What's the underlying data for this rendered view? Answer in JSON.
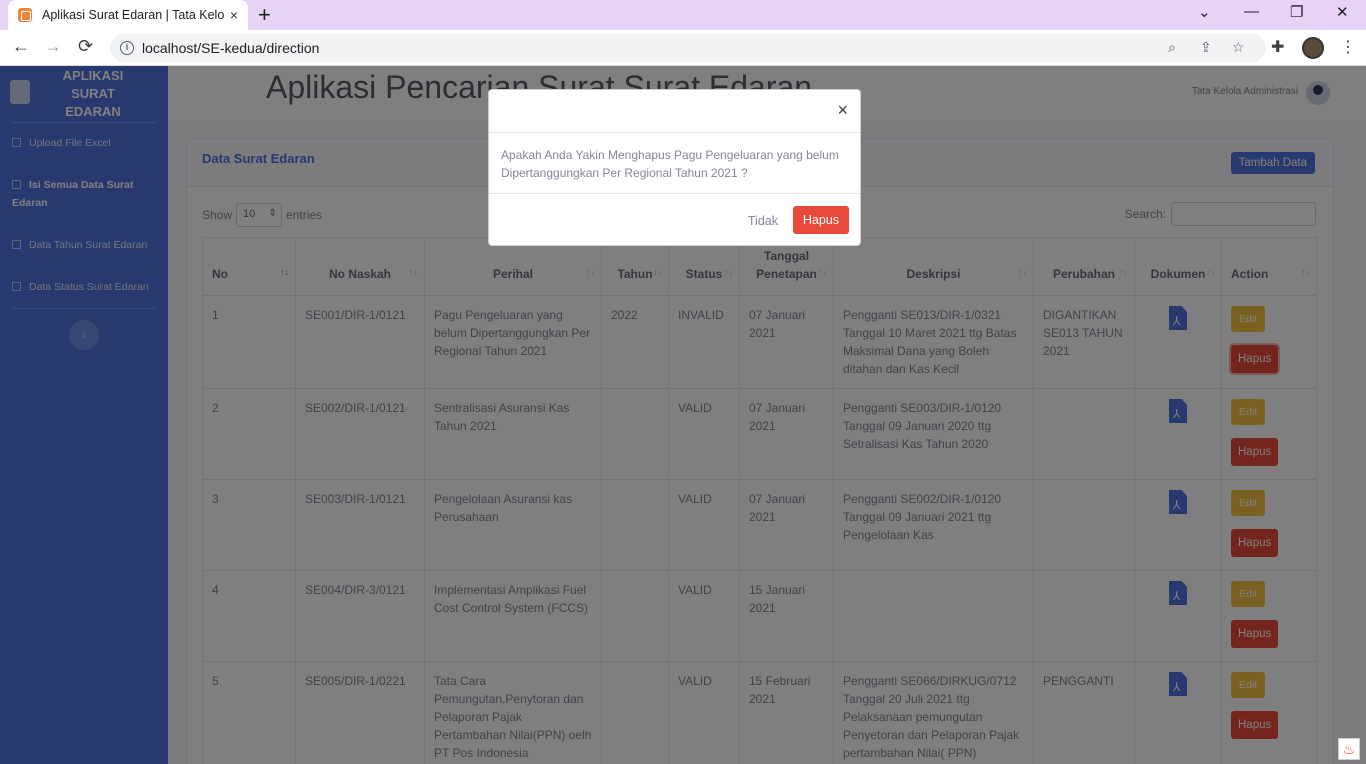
{
  "browser": {
    "tab_title": "Aplikasi Surat Edaran | Tata Kelola Administrasi",
    "tab_close": "×",
    "new_tab": "+",
    "url": "localhost/SE-kedua/direction",
    "controls": {
      "minimize": "—",
      "restore": "❐",
      "close": "✕",
      "dropdown": "⌄"
    },
    "nav": {
      "back": "←",
      "forward": "→",
      "reload": "⟳"
    }
  },
  "sidebar": {
    "brand": "APLIKASI SURAT EDARAN",
    "items": [
      {
        "label": "Upload File Excel"
      },
      {
        "label": "Isi Semua Data Surat Edaran"
      },
      {
        "label": "Data Tahun Surat Edaran"
      },
      {
        "label": "Data Status Surat Edaran"
      }
    ],
    "toggle": "‹"
  },
  "topbar": {
    "title": "Aplikasi Pencarian Surat Surat Edaran",
    "user": "Tata Kelola Administrasi"
  },
  "card": {
    "title": "Data Surat Edaran",
    "add_button": "Tambah Data",
    "show_label": "Show",
    "entries_value": "10",
    "entries_label": "entries",
    "search_label": "Search:"
  },
  "table": {
    "headers": [
      "No",
      "No Naskah",
      "Perihal",
      "Tahun",
      "Status",
      "Tanggal Penetapan",
      "Deskripsi",
      "Perubahan",
      "Dokumen",
      "Action"
    ],
    "rows": [
      {
        "no": "1",
        "naskah": "SE001/DIR-1/0121",
        "perihal": "Pagu Pengeluaran yang belum Dipertanggungkan Per Regional Tahun 2021",
        "tahun": "2022",
        "status": "INVALID",
        "tanggal": "07 Januari 2021",
        "deskripsi": "Pengganti SE013/DIR-1/0321 Tanggal 10 Maret 2021 ttg Batas Maksimal Dana yang Boleh ditahan dan Kas Kecil",
        "perubahan": "DIGANTIKAN SE013 TAHUN 2021"
      },
      {
        "no": "2",
        "naskah": "SE002/DIR-1/0121",
        "perihal": "Sentralisasi Asuransi Kas Tahun 2021",
        "tahun": "",
        "status": "VALID",
        "tanggal": "07 Januari 2021",
        "deskripsi": "Pengganti SE003/DIR-1/0120 Tanggal 09 Januari 2020 ttg Setralisasi Kas Tahun 2020",
        "perubahan": ""
      },
      {
        "no": "3",
        "naskah": "SE003/DIR-1/0121",
        "perihal": "Pengelolaan Asuransi kas Perusahaan",
        "tahun": "",
        "status": "VALID",
        "tanggal": "07 Januari 2021",
        "deskripsi": "Pengganti SE002/DIR-1/0120 Tanggal 09 Januari 2021 ttg Pengelolaan Kas",
        "perubahan": ""
      },
      {
        "no": "4",
        "naskah": "SE004/DIR-3/0121",
        "perihal": "Implementasi Amplikasi Fuel Cost Control System (FCCS)",
        "tahun": "",
        "status": "VALID",
        "tanggal": "15 Januari 2021",
        "deskripsi": "",
        "perubahan": ""
      },
      {
        "no": "5",
        "naskah": "SE005/DIR-1/0221",
        "perihal": "Tata Cara Pemungutan,Penytoran dan Pelaporan Pajak Pertambahan Nilai(PPN) oelh PT Pos Indonesia",
        "tahun": "",
        "status": "VALID",
        "tanggal": "15 Februari 2021",
        "deskripsi": "Pengganti SE066/DIRKUG/0712 Tanggal 20 Juli 2021 ttg Pelaksanaan pemungutan Penyetoran dan Pelaporan Pajak pertambahan Nilai( PPN)",
        "perubahan": "PENGGANTI"
      }
    ],
    "edit_label": "Edit",
    "hapus_label": "Hapus"
  },
  "modal": {
    "close": "×",
    "message": "Apakah Anda Yakin Menghapus Pagu Pengeluaran yang belum Dipertanggungkan Per Regional Tahun 2021 ?",
    "cancel": "Tidak",
    "confirm": "Hapus"
  }
}
